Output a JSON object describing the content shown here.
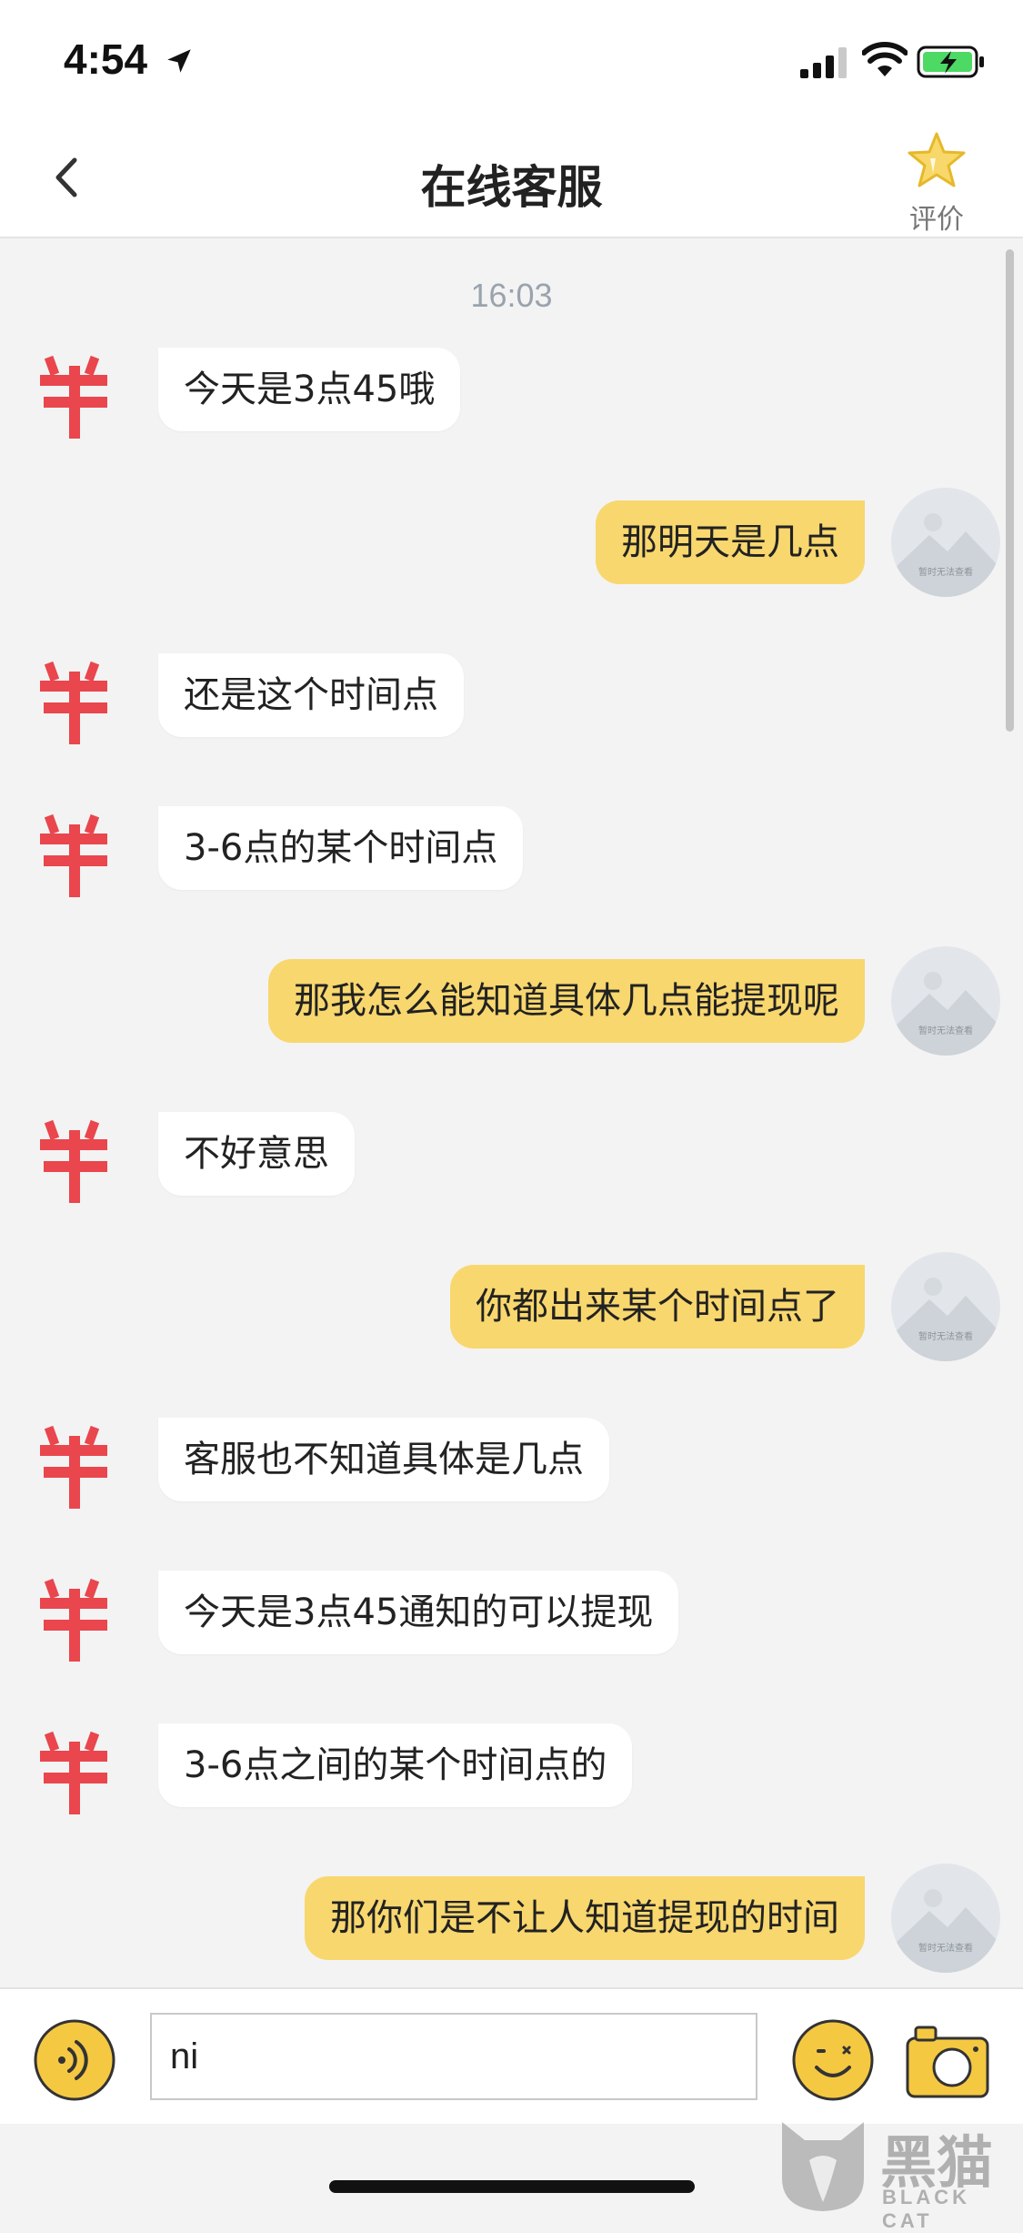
{
  "status_bar": {
    "time": "4:54"
  },
  "nav": {
    "title": "在线客服",
    "rate_label": "评价"
  },
  "chat": {
    "timestamp": "16:03",
    "user_avatar_caption": "暂时无法查看",
    "messages": [
      {
        "sender": "agent",
        "text": "今天是3点45哦"
      },
      {
        "sender": "user",
        "text": "那明天是几点"
      },
      {
        "sender": "agent",
        "text": "还是这个时间点"
      },
      {
        "sender": "agent",
        "text": "3-6点的某个时间点"
      },
      {
        "sender": "user",
        "text": "那我怎么能知道具体几点能提现呢"
      },
      {
        "sender": "agent",
        "text": "不好意思"
      },
      {
        "sender": "user",
        "text": "你都出来某个时间点了"
      },
      {
        "sender": "agent",
        "text": "客服也不知道具体是几点"
      },
      {
        "sender": "agent",
        "text": "今天是3点45通知的可以提现"
      },
      {
        "sender": "agent",
        "text": "3-6点之间的某个时间点的"
      },
      {
        "sender": "user",
        "text": "那你们是不让人知道提现的时间"
      }
    ]
  },
  "input": {
    "value": "ni"
  },
  "watermark": {
    "text": "黑猫",
    "subtext": "BLACK CAT"
  },
  "colors": {
    "user_bubble": "#f8d76e",
    "agent_bubble": "#ffffff",
    "accent": "#f5c842",
    "agent_avatar": "#e8343c"
  }
}
